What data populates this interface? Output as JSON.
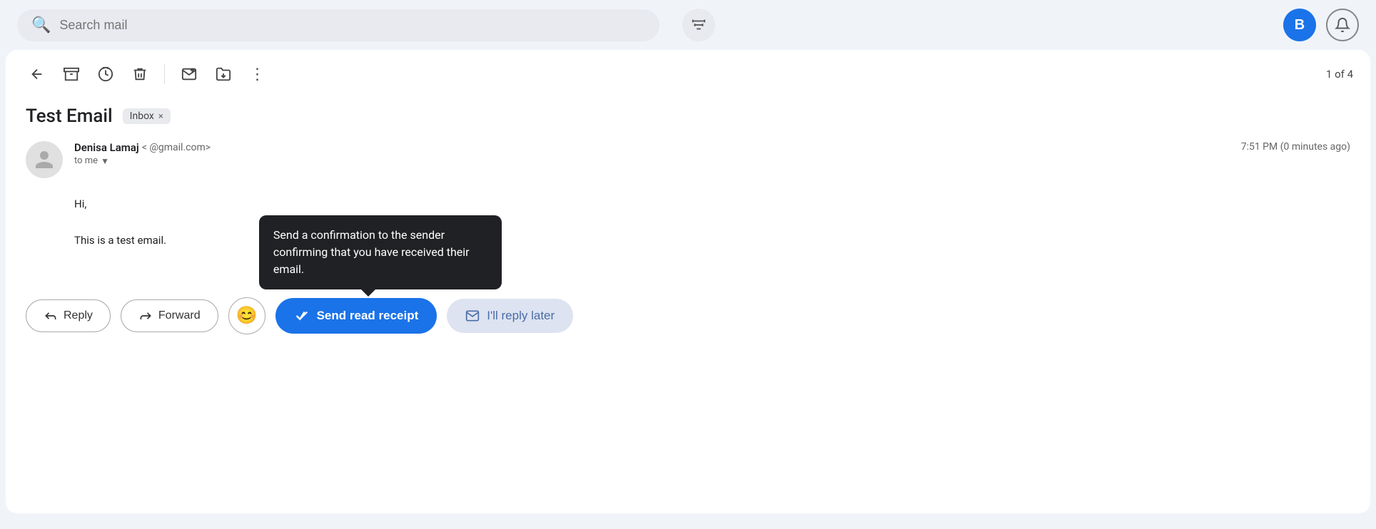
{
  "search": {
    "placeholder": "Search mail"
  },
  "header": {
    "email_counter": "1 of 4",
    "avatar_letter": "B"
  },
  "toolbar": {
    "back_label": "←",
    "archive_label": "⬇",
    "snooze_label": "⏰",
    "delete_label": "🗑",
    "mark_unread_label": "✉",
    "move_label": "📁",
    "more_label": "⋮"
  },
  "email": {
    "subject": "Test Email",
    "inbox_badge": "Inbox",
    "inbox_badge_x": "×",
    "sender_name": "Denisa Lamaj",
    "sender_email_prefix": "<",
    "sender_email_domain": "@gmail.com>",
    "to_me": "to me",
    "timestamp": "7:51 PM (0 minutes ago)",
    "body_line1": "Hi,",
    "body_line2": "This is a test email."
  },
  "actions": {
    "reply_label": "Reply",
    "forward_label": "Forward",
    "emoji_icon": "😊",
    "send_read_receipt_label": "Send read receipt",
    "reply_later_label": "I'll reply later"
  },
  "tooltip": {
    "text": "Send a confirmation to the sender confirming that you have received their email."
  }
}
